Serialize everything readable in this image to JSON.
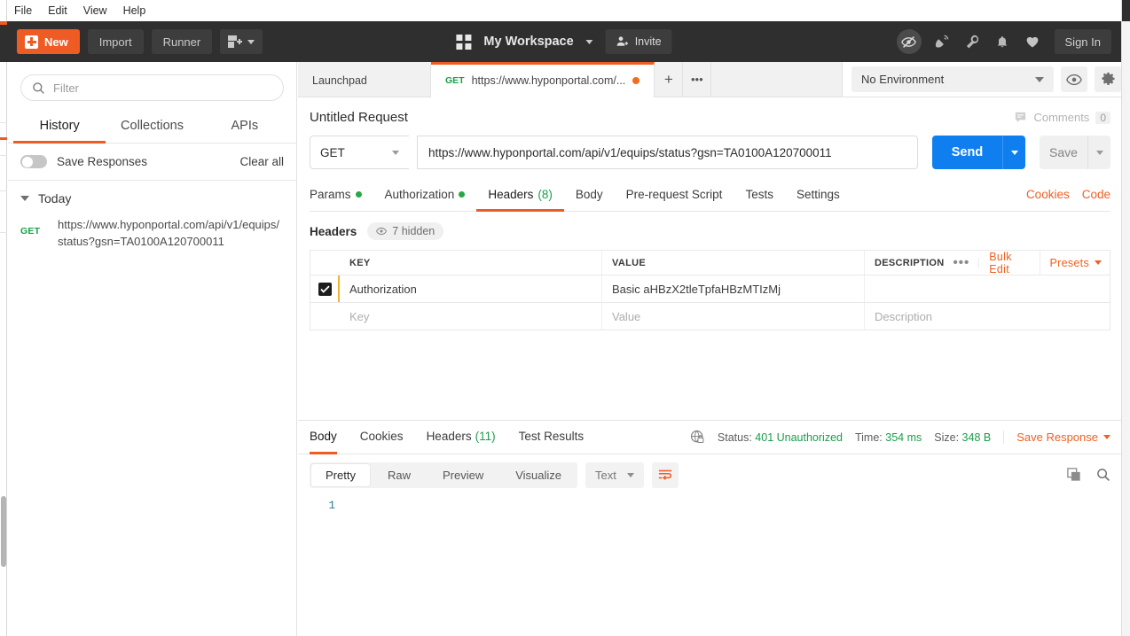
{
  "menubar": {
    "items": [
      "File",
      "Edit",
      "View",
      "Help"
    ]
  },
  "header": {
    "new_label": "New",
    "import_label": "Import",
    "runner_label": "Runner",
    "new_collection_icon": "new-collection-icon",
    "workspace_label": "My Workspace",
    "invite_label": "Invite",
    "icons": [
      "eye-off-icon",
      "satellite-icon",
      "wrench-icon",
      "bell-icon",
      "heart-icon"
    ],
    "sign_in_label": "Sign In",
    "accent_color": "#ef5b25",
    "bg_color": "#2f2f2f"
  },
  "sidebar": {
    "filter_placeholder": "Filter",
    "search_icon": "search-icon",
    "tabs": [
      {
        "label": "History",
        "active": true
      },
      {
        "label": "Collections",
        "active": false
      },
      {
        "label": "APIs",
        "active": false
      }
    ],
    "save_responses_label": "Save Responses",
    "save_responses_on": false,
    "clear_all_label": "Clear all",
    "groups": [
      {
        "label": "Today",
        "items": [
          {
            "method": "GET",
            "url": "https://www.hyponportal.com/api/v1/equips/status?gsn=TA0100A120700011"
          }
        ]
      }
    ]
  },
  "tabbar": {
    "tabs": [
      {
        "label": "Launchpad",
        "method": "",
        "active": false,
        "unsaved": false
      },
      {
        "label": "https://www.hyponportal.com/...",
        "method": "GET",
        "active": true,
        "unsaved": true
      }
    ],
    "add_label": "+",
    "more_label": "•••",
    "environment": "No Environment",
    "eye_icon": "eye-icon",
    "gear_icon": "gear-icon"
  },
  "request": {
    "title": "Untitled Request",
    "comments_label": "Comments",
    "comments_count": "0",
    "method": "GET",
    "url": "https://www.hyponportal.com/api/v1/equips/status?gsn=TA0100A120700011",
    "send_label": "Send",
    "save_label": "Save",
    "tabs": [
      {
        "label": "Params",
        "dot": true,
        "count": "",
        "active": false
      },
      {
        "label": "Authorization",
        "dot": true,
        "count": "",
        "active": false
      },
      {
        "label": "Headers",
        "dot": false,
        "count": "(8)",
        "active": true
      },
      {
        "label": "Body",
        "dot": false,
        "count": "",
        "active": false
      },
      {
        "label": "Pre-request Script",
        "dot": false,
        "count": "",
        "active": false
      },
      {
        "label": "Tests",
        "dot": false,
        "count": "",
        "active": false
      },
      {
        "label": "Settings",
        "dot": false,
        "count": "",
        "active": false
      }
    ],
    "cookies_label": "Cookies",
    "code_label": "Code",
    "headers_section_label": "Headers",
    "hidden_pill_label": "7 hidden",
    "hidden_pill_icon": "eye-icon",
    "table": {
      "columns": [
        "KEY",
        "VALUE",
        "DESCRIPTION"
      ],
      "bulk_edit_label": "Bulk Edit",
      "presets_label": "Presets",
      "more_label": "•••",
      "rows": [
        {
          "checked": true,
          "key": "Authorization",
          "value": "Basic aHBzX2tleTpfaHBzMTIzMj",
          "description": ""
        }
      ],
      "placeholder_row": {
        "key": "Key",
        "value": "Value",
        "description": "Description"
      }
    }
  },
  "response": {
    "tabs": [
      {
        "label": "Body",
        "count": "",
        "active": true
      },
      {
        "label": "Cookies",
        "count": "",
        "active": false
      },
      {
        "label": "Headers",
        "count": "(11)",
        "active": false
      },
      {
        "label": "Test Results",
        "count": "",
        "active": false
      }
    ],
    "lock_icon": "globe-lock-icon",
    "status_label": "Status:",
    "status_value": "401 Unauthorized",
    "time_label": "Time:",
    "time_value": "354 ms",
    "size_label": "Size:",
    "size_value": "348 B",
    "save_response_label": "Save Response",
    "view_modes": [
      {
        "label": "Pretty",
        "active": true
      },
      {
        "label": "Raw",
        "active": false
      },
      {
        "label": "Preview",
        "active": false
      },
      {
        "label": "Visualize",
        "active": false
      }
    ],
    "format": "Text",
    "wrap_icon": "word-wrap-icon",
    "copy_icon": "copy-icon",
    "search_icon": "search-icon",
    "body_lines": [
      "1"
    ],
    "body_content": ""
  }
}
